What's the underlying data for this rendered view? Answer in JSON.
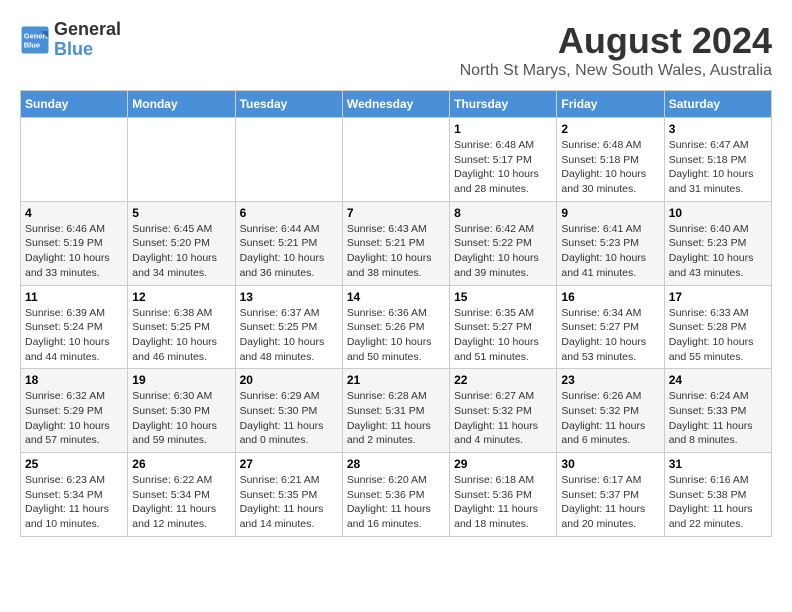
{
  "header": {
    "logo_line1": "General",
    "logo_line2": "Blue",
    "month_year": "August 2024",
    "location": "North St Marys, New South Wales, Australia"
  },
  "weekdays": [
    "Sunday",
    "Monday",
    "Tuesday",
    "Wednesday",
    "Thursday",
    "Friday",
    "Saturday"
  ],
  "weeks": [
    [
      {
        "day": "",
        "info": ""
      },
      {
        "day": "",
        "info": ""
      },
      {
        "day": "",
        "info": ""
      },
      {
        "day": "",
        "info": ""
      },
      {
        "day": "1",
        "info": "Sunrise: 6:48 AM\nSunset: 5:17 PM\nDaylight: 10 hours\nand 28 minutes."
      },
      {
        "day": "2",
        "info": "Sunrise: 6:48 AM\nSunset: 5:18 PM\nDaylight: 10 hours\nand 30 minutes."
      },
      {
        "day": "3",
        "info": "Sunrise: 6:47 AM\nSunset: 5:18 PM\nDaylight: 10 hours\nand 31 minutes."
      }
    ],
    [
      {
        "day": "4",
        "info": "Sunrise: 6:46 AM\nSunset: 5:19 PM\nDaylight: 10 hours\nand 33 minutes."
      },
      {
        "day": "5",
        "info": "Sunrise: 6:45 AM\nSunset: 5:20 PM\nDaylight: 10 hours\nand 34 minutes."
      },
      {
        "day": "6",
        "info": "Sunrise: 6:44 AM\nSunset: 5:21 PM\nDaylight: 10 hours\nand 36 minutes."
      },
      {
        "day": "7",
        "info": "Sunrise: 6:43 AM\nSunset: 5:21 PM\nDaylight: 10 hours\nand 38 minutes."
      },
      {
        "day": "8",
        "info": "Sunrise: 6:42 AM\nSunset: 5:22 PM\nDaylight: 10 hours\nand 39 minutes."
      },
      {
        "day": "9",
        "info": "Sunrise: 6:41 AM\nSunset: 5:23 PM\nDaylight: 10 hours\nand 41 minutes."
      },
      {
        "day": "10",
        "info": "Sunrise: 6:40 AM\nSunset: 5:23 PM\nDaylight: 10 hours\nand 43 minutes."
      }
    ],
    [
      {
        "day": "11",
        "info": "Sunrise: 6:39 AM\nSunset: 5:24 PM\nDaylight: 10 hours\nand 44 minutes."
      },
      {
        "day": "12",
        "info": "Sunrise: 6:38 AM\nSunset: 5:25 PM\nDaylight: 10 hours\nand 46 minutes."
      },
      {
        "day": "13",
        "info": "Sunrise: 6:37 AM\nSunset: 5:25 PM\nDaylight: 10 hours\nand 48 minutes."
      },
      {
        "day": "14",
        "info": "Sunrise: 6:36 AM\nSunset: 5:26 PM\nDaylight: 10 hours\nand 50 minutes."
      },
      {
        "day": "15",
        "info": "Sunrise: 6:35 AM\nSunset: 5:27 PM\nDaylight: 10 hours\nand 51 minutes."
      },
      {
        "day": "16",
        "info": "Sunrise: 6:34 AM\nSunset: 5:27 PM\nDaylight: 10 hours\nand 53 minutes."
      },
      {
        "day": "17",
        "info": "Sunrise: 6:33 AM\nSunset: 5:28 PM\nDaylight: 10 hours\nand 55 minutes."
      }
    ],
    [
      {
        "day": "18",
        "info": "Sunrise: 6:32 AM\nSunset: 5:29 PM\nDaylight: 10 hours\nand 57 minutes."
      },
      {
        "day": "19",
        "info": "Sunrise: 6:30 AM\nSunset: 5:30 PM\nDaylight: 10 hours\nand 59 minutes."
      },
      {
        "day": "20",
        "info": "Sunrise: 6:29 AM\nSunset: 5:30 PM\nDaylight: 11 hours\nand 0 minutes."
      },
      {
        "day": "21",
        "info": "Sunrise: 6:28 AM\nSunset: 5:31 PM\nDaylight: 11 hours\nand 2 minutes."
      },
      {
        "day": "22",
        "info": "Sunrise: 6:27 AM\nSunset: 5:32 PM\nDaylight: 11 hours\nand 4 minutes."
      },
      {
        "day": "23",
        "info": "Sunrise: 6:26 AM\nSunset: 5:32 PM\nDaylight: 11 hours\nand 6 minutes."
      },
      {
        "day": "24",
        "info": "Sunrise: 6:24 AM\nSunset: 5:33 PM\nDaylight: 11 hours\nand 8 minutes."
      }
    ],
    [
      {
        "day": "25",
        "info": "Sunrise: 6:23 AM\nSunset: 5:34 PM\nDaylight: 11 hours\nand 10 minutes."
      },
      {
        "day": "26",
        "info": "Sunrise: 6:22 AM\nSunset: 5:34 PM\nDaylight: 11 hours\nand 12 minutes."
      },
      {
        "day": "27",
        "info": "Sunrise: 6:21 AM\nSunset: 5:35 PM\nDaylight: 11 hours\nand 14 minutes."
      },
      {
        "day": "28",
        "info": "Sunrise: 6:20 AM\nSunset: 5:36 PM\nDaylight: 11 hours\nand 16 minutes."
      },
      {
        "day": "29",
        "info": "Sunrise: 6:18 AM\nSunset: 5:36 PM\nDaylight: 11 hours\nand 18 minutes."
      },
      {
        "day": "30",
        "info": "Sunrise: 6:17 AM\nSunset: 5:37 PM\nDaylight: 11 hours\nand 20 minutes."
      },
      {
        "day": "31",
        "info": "Sunrise: 6:16 AM\nSunset: 5:38 PM\nDaylight: 11 hours\nand 22 minutes."
      }
    ]
  ]
}
